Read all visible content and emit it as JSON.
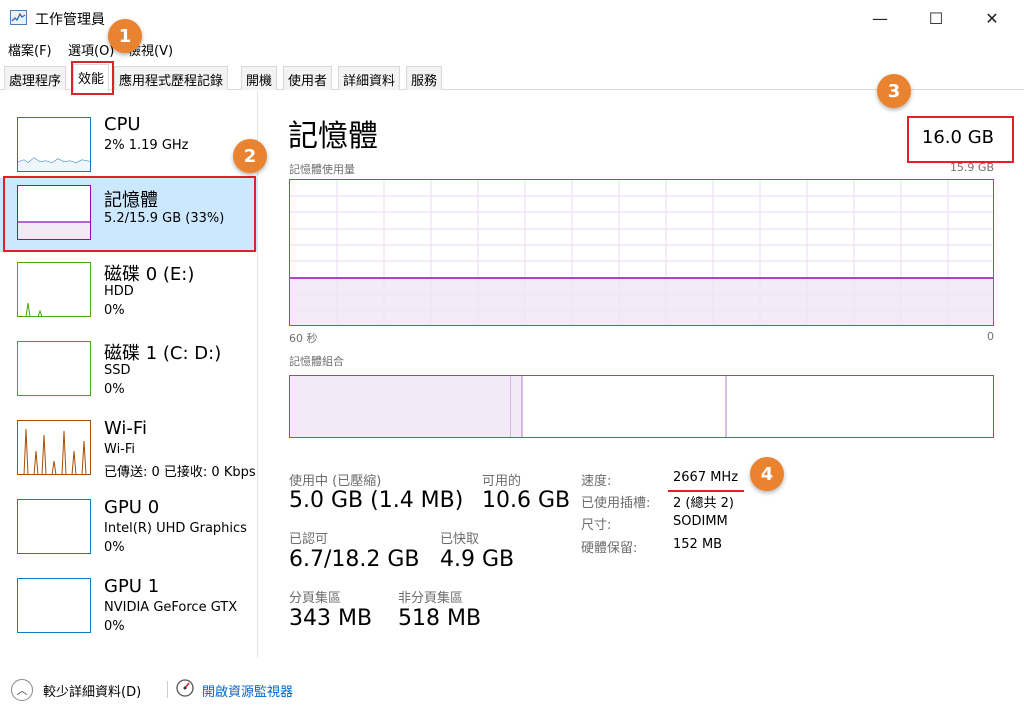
{
  "window": {
    "title": "工作管理員",
    "minimize": "—",
    "maximize": "☐",
    "close": "✕"
  },
  "menu": [
    "檔案(F)",
    "選項(O)",
    "檢視(V)"
  ],
  "tabs": [
    "處理程序",
    "效能",
    "應用程式歷程記錄",
    "開機",
    "使用者",
    "詳細資料",
    "服務"
  ],
  "sidebar": [
    {
      "name": "CPU",
      "sub1": "2% 1.19 GHz",
      "sub2": "",
      "color": "#117dbb"
    },
    {
      "name": "記憶體",
      "sub1": "5.2/15.9 GB (33%)",
      "sub2": "",
      "color": "#8b12ae"
    },
    {
      "name": "磁碟 0 (E:)",
      "sub1": "HDD",
      "sub2": "0%",
      "color": "#4da60c"
    },
    {
      "name": "磁碟 1 (C: D:)",
      "sub1": "SSD",
      "sub2": "0%",
      "color": "#4da60c"
    },
    {
      "name": "Wi-Fi",
      "sub1": "Wi-Fi",
      "sub2": "已傳送: 0 已接收: 0 Kbps",
      "color": "#a74f01"
    },
    {
      "name": "GPU 0",
      "sub1": "Intel(R) UHD Graphics",
      "sub2": "0%",
      "color": "#117dbb"
    },
    {
      "name": "GPU 1",
      "sub1": "NVIDIA GeForce GTX",
      "sub2": "0%",
      "color": "#117dbb"
    }
  ],
  "main": {
    "title": "記憶體",
    "total": "16.0 GB",
    "usage_label": "記憶體使用量",
    "usage_max": "15.9 GB",
    "axis_left": "60 秒",
    "axis_right": "0",
    "composition_label": "記憶體組合",
    "stats": {
      "in_use_label": "使用中 (已壓縮)",
      "in_use_value": "5.0 GB (1.4 MB)",
      "available_label": "可用的",
      "available_value": "10.6 GB",
      "committed_label": "已認可",
      "committed_value": "6.7/18.2 GB",
      "cached_label": "已快取",
      "cached_value": "4.9 GB",
      "paged_label": "分頁集區",
      "paged_value": "343 MB",
      "nonpaged_label": "非分頁集區",
      "nonpaged_value": "518 MB"
    },
    "details": {
      "speed_label": "速度:",
      "speed_value": "2667 MHz",
      "slots_label": "已使用插槽:",
      "slots_value": "2 (總共 2)",
      "form_label": "尺寸:",
      "form_value": "SODIMM",
      "reserved_label": "硬體保留:",
      "reserved_value": "152 MB"
    },
    "usage_fraction": 0.33
  },
  "bottom": {
    "fewer_details": "較少詳細資料(D)",
    "resource_monitor": "開啟資源監視器"
  },
  "annotations": [
    "1",
    "2",
    "3",
    "4"
  ],
  "colors": {
    "memory": "#8b12ae",
    "highlight": "#e0202b",
    "badge": "#e9832f",
    "link": "#0066cc"
  }
}
